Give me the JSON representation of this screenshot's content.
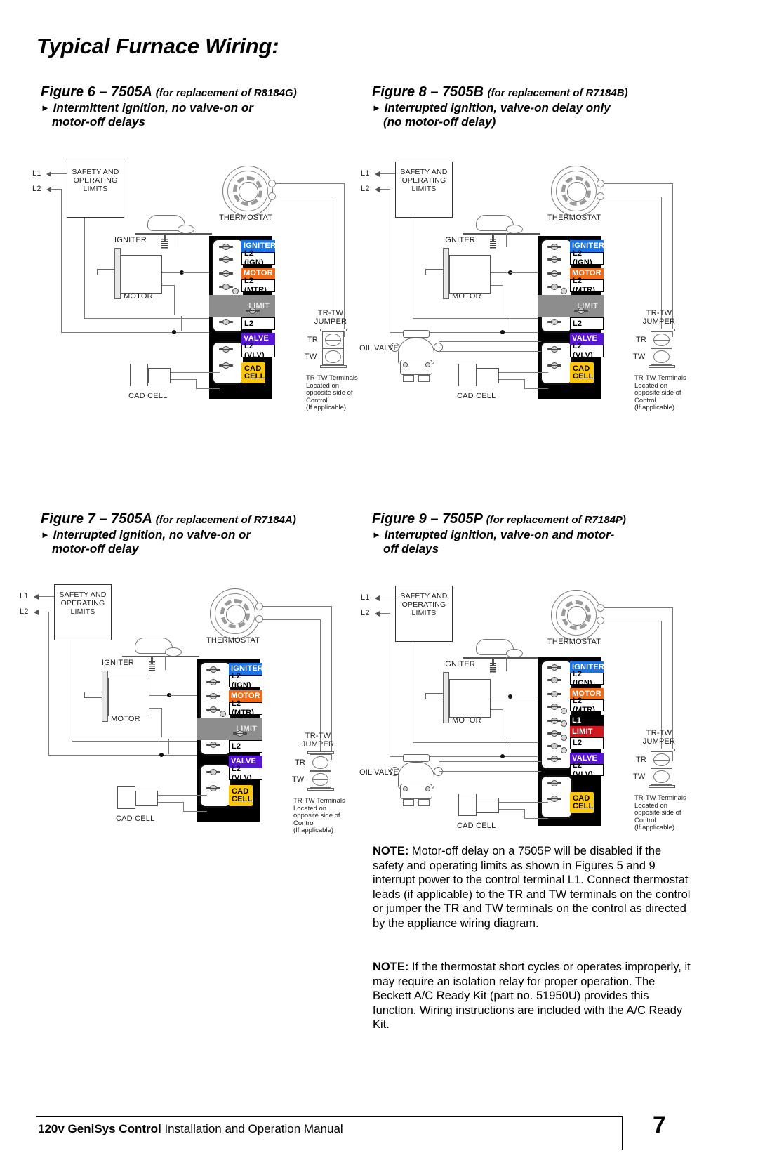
{
  "page": {
    "title": "Typical Furnace Wiring:",
    "number": "7",
    "footer_bold": "120v GeniSys Control",
    "footer_rest": " Installation and Operation Manual"
  },
  "figures": [
    {
      "id": "figure-6",
      "title": "Figure 6 – 7505A",
      "subtitle": "(for replacement of R8184G)",
      "bullet_line1": "Intermittent ignition, no valve-on or",
      "bullet_line2": "motor-off delays",
      "labels": {
        "l1": "L1",
        "l2": "L2",
        "safety": "SAFETY AND\nOPERATING\nLIMITS",
        "igniter": "IGNITER",
        "motor": "MOTOR",
        "thermostat": "THERMOSTAT",
        "cad_cell": "CAD CELL",
        "trtw_jumper": "TR-TW\nJUMPER",
        "tr": "TR",
        "tw": "TW",
        "trtw_note": "TR-TW Terminals\nLocated on\nopposite side of\nControl\n(If applicable)"
      },
      "terminals": [
        {
          "label": "IGNITER",
          "style": "igniter"
        },
        {
          "label": "L2 (IGN)",
          "style": "white"
        },
        {
          "label": "MOTOR",
          "style": "motor"
        },
        {
          "label": "L2 (MTR)",
          "style": "white"
        },
        {
          "label": "LIMIT",
          "style": "limitgray"
        },
        {
          "label": "L2",
          "style": "white"
        },
        {
          "label": "VALVE",
          "style": "valve"
        },
        {
          "label": "L2 (VLV)",
          "style": "white"
        },
        {
          "label": "CAD\nCELL",
          "style": "cad"
        }
      ]
    },
    {
      "id": "figure-8",
      "title": "Figure 8 – 7505B",
      "subtitle": "(for replacement of R7184B)",
      "bullet_line1": "Interrupted ignition, valve-on delay only",
      "bullet_line2": "(no motor-off delay)",
      "labels": {
        "l1": "L1",
        "l2": "L2",
        "safety": "SAFETY AND\nOPERATING\nLIMITS",
        "igniter": "IGNITER",
        "motor": "MOTOR",
        "thermostat": "THERMOSTAT",
        "cad_cell": "CAD CELL",
        "oil_valve": "OIL VALVE",
        "trtw_jumper": "TR-TW\nJUMPER",
        "tr": "TR",
        "tw": "TW",
        "trtw_note": "TR-TW Terminals\nLocated on\nopposite side of\nControl\n(If applicable)"
      },
      "terminals": [
        {
          "label": "IGNITER",
          "style": "igniter"
        },
        {
          "label": "L2 (IGN)",
          "style": "white"
        },
        {
          "label": "MOTOR",
          "style": "motor"
        },
        {
          "label": "L2 (MTR)",
          "style": "white"
        },
        {
          "label": "LIMIT",
          "style": "limitgray"
        },
        {
          "label": "L2",
          "style": "white"
        },
        {
          "label": "VALVE",
          "style": "valve"
        },
        {
          "label": "L2 (VLV)",
          "style": "white"
        },
        {
          "label": "CAD\nCELL",
          "style": "cad"
        }
      ]
    },
    {
      "id": "figure-7",
      "title": "Figure 7 – 7505A",
      "subtitle": "(for replacement of R7184A)",
      "bullet_line1": "Interrupted ignition, no valve-on or",
      "bullet_line2": "motor-off delay",
      "labels": {
        "l1": "L1",
        "l2": "L2",
        "safety": "SAFETY AND\nOPERATING\nLIMITS",
        "igniter": "IGNITER",
        "motor": "MOTOR",
        "thermostat": "THERMOSTAT",
        "cad_cell": "CAD CELL",
        "trtw_jumper": "TR-TW\nJUMPER",
        "tr": "TR",
        "tw": "TW",
        "trtw_note": "TR-TW Terminals\nLocated on\nopposite side of\nControl\n(If applicable)"
      },
      "terminals": [
        {
          "label": "IGNITER",
          "style": "igniter"
        },
        {
          "label": "L2 (IGN)",
          "style": "white"
        },
        {
          "label": "MOTOR",
          "style": "motor"
        },
        {
          "label": "L2 (MTR)",
          "style": "white"
        },
        {
          "label": "LIMIT",
          "style": "limitgray"
        },
        {
          "label": "L2",
          "style": "white"
        },
        {
          "label": "VALVE",
          "style": "valve"
        },
        {
          "label": "L2 (VLV)",
          "style": "white"
        },
        {
          "label": "CAD\nCELL",
          "style": "cad"
        }
      ]
    },
    {
      "id": "figure-9",
      "title": "Figure 9 – 7505P",
      "subtitle": "(for replacement of R7184P)",
      "bullet_line1": "Interrupted ignition, valve-on and motor-",
      "bullet_line2": "off delays",
      "labels": {
        "l1": "L1",
        "l2": "L2",
        "safety": "SAFETY AND\nOPERATING\nLIMITS",
        "igniter": "IGNITER",
        "motor": "MOTOR",
        "thermostat": "THERMOSTAT",
        "cad_cell": "CAD CELL",
        "oil_valve": "OIL VALVE",
        "trtw_jumper": "TR-TW\nJUMPER",
        "tr": "TR",
        "tw": "TW",
        "trtw_note": "TR-TW Terminals\nLocated on\nopposite side of\nControl\n(If applicable)"
      },
      "terminals": [
        {
          "label": "IGNITER",
          "style": "igniter"
        },
        {
          "label": "L2 (IGN)",
          "style": "white"
        },
        {
          "label": "MOTOR",
          "style": "motor"
        },
        {
          "label": "L2 (MTR)",
          "style": "white"
        },
        {
          "label": "L1",
          "style": "l1blk"
        },
        {
          "label": "LIMIT",
          "style": "limitred"
        },
        {
          "label": "L2",
          "style": "white"
        },
        {
          "label": "VALVE",
          "style": "valve"
        },
        {
          "label": "L2 (VLV)",
          "style": "white"
        },
        {
          "label": "CAD\nCELL",
          "style": "cad"
        }
      ]
    }
  ],
  "notes": [
    {
      "bold": "NOTE:",
      "text": " Motor-off delay on a 7505P will be disabled if the safety and operating limits as shown in Figures 5 and 9 interrupt power to the control terminal L1. Connect thermostat leads (if applicable) to the TR and TW terminals on the control or jumper the TR and TW terminals on the control as directed by the appliance wiring diagram."
    },
    {
      "bold": "NOTE:",
      "text": " If the thermostat short cycles or operates improperly, it may require an isolation relay for proper operation. The Beckett A/C Ready Kit (part no. 51950U) provides this function.  Wiring instructions are included with the A/C Ready Kit."
    }
  ],
  "colors": {
    "igniter": "#1673e8",
    "motor": "#f26a16",
    "valve": "#5a14d6",
    "cad_cell": "#fcc60a",
    "limit_gray": "#8d8d8d",
    "limit_red": "#d0191e"
  }
}
